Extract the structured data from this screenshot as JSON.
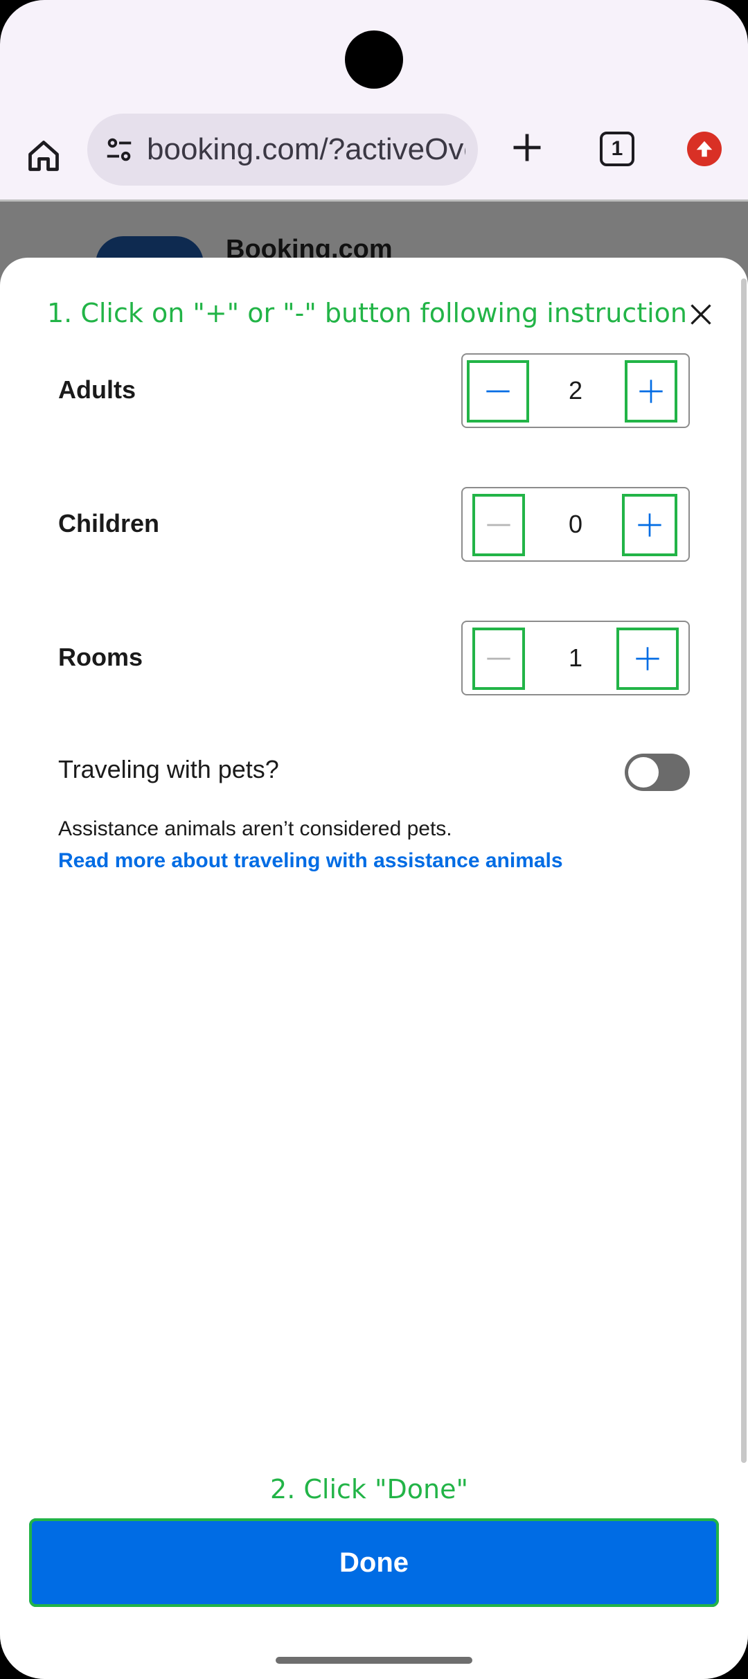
{
  "browser": {
    "url": "booking.com/?activeOverlay",
    "tab_count": "1",
    "icons": {
      "home": "home-icon",
      "site_settings": "tune-icon",
      "new_tab": "plus-icon",
      "tabs": "tab-switcher-icon",
      "update": "update-arrow-icon"
    }
  },
  "background_page": {
    "title": "Booking.com"
  },
  "sheet": {
    "instruction_top": "1. Click on \"+\" or \"-\" button following instruction",
    "rows": [
      {
        "label": "Adults",
        "value": "2"
      },
      {
        "label": "Children",
        "value": "0"
      },
      {
        "label": "Rooms",
        "value": "1"
      }
    ],
    "pets_label": "Traveling with pets?",
    "pets_enabled": false,
    "assist_text": "Assistance animals aren’t considered pets.",
    "assist_link": "Read more about traveling with assistance animals",
    "instruction_bottom": "2. Click \"Done\"",
    "done_label": "Done"
  },
  "colors": {
    "accent": "#006ce4",
    "instruction": "#22b447",
    "update_badge": "#d93025"
  }
}
